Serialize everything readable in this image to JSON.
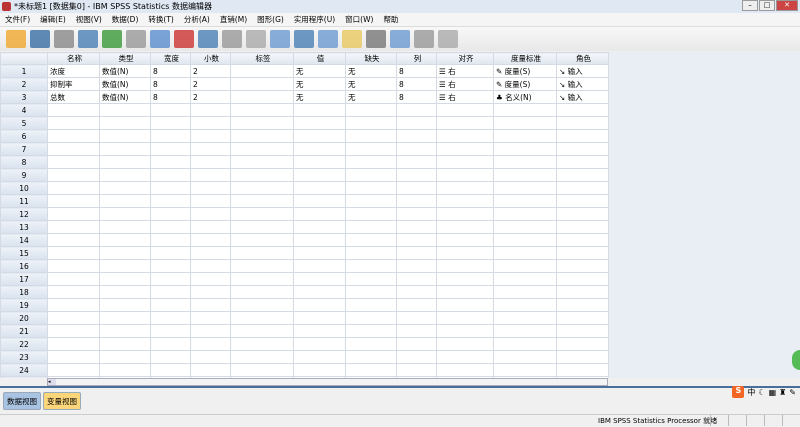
{
  "title": "*未标题1 [数据集0] - IBM SPSS Statistics 数据编辑器",
  "menu": [
    "文件(F)",
    "编辑(E)",
    "视图(V)",
    "数据(D)",
    "转换(T)",
    "分析(A)",
    "直销(M)",
    "图形(G)",
    "实用程序(U)",
    "窗口(W)",
    "帮助"
  ],
  "columns": [
    "名称",
    "类型",
    "宽度",
    "小数",
    "标签",
    "值",
    "缺失",
    "列",
    "对齐",
    "度量标准",
    "角色"
  ],
  "rows": [
    [
      "浓度",
      "数值(N)",
      "8",
      "2",
      "",
      "无",
      "无",
      "8",
      "☰ 右",
      "✎ 度量(S)",
      "↘ 输入"
    ],
    [
      "抑制率",
      "数值(N)",
      "8",
      "2",
      "",
      "无",
      "无",
      "8",
      "☰ 右",
      "✎ 度量(S)",
      "↘ 输入"
    ],
    [
      "总数",
      "数值(N)",
      "8",
      "2",
      "",
      "无",
      "无",
      "8",
      "☰ 右",
      "♣ 名义(N)",
      "↘ 输入"
    ]
  ],
  "row_count": 26,
  "tabs": {
    "data_view": "数据视图",
    "variable_view": "变量视图"
  },
  "ime": [
    "S",
    "中"
  ],
  "status": "IBM SPSS Statistics Processor 就绪"
}
